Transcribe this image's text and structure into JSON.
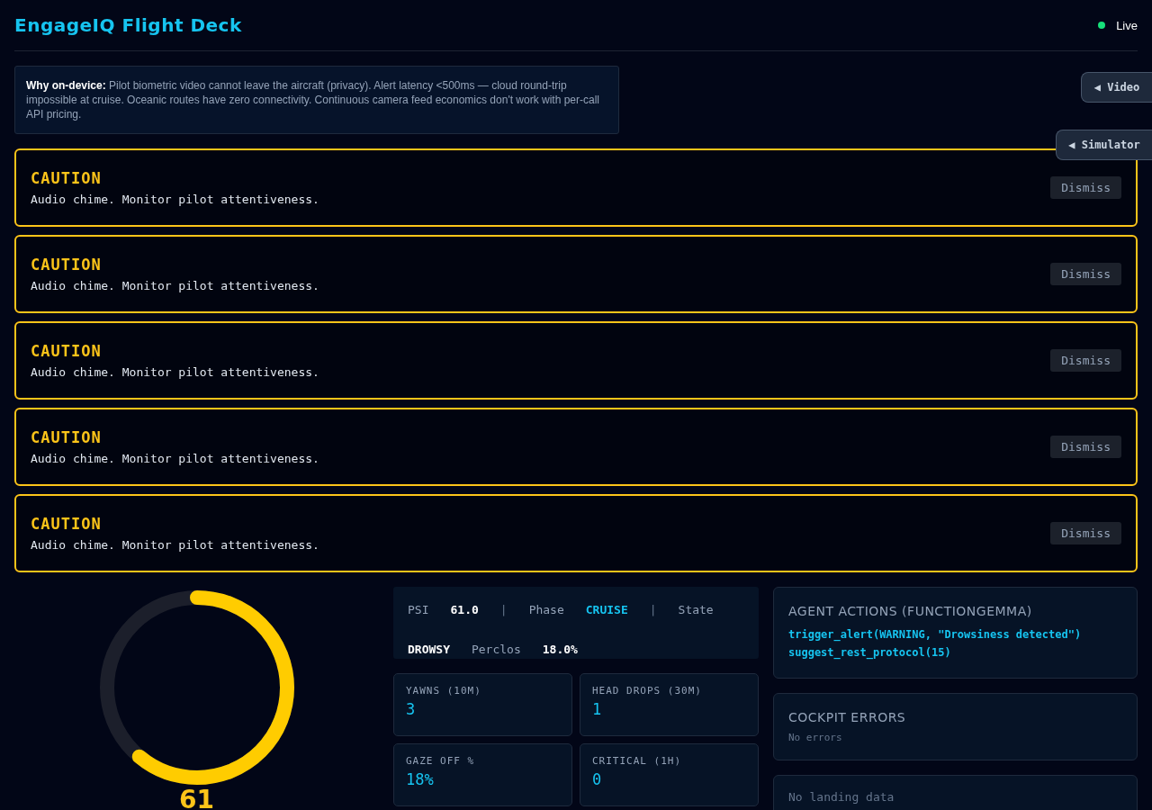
{
  "header": {
    "title": "EngageIQ Flight Deck",
    "status": {
      "label": "Live",
      "on": true
    }
  },
  "info": "**Why on-device:** Pilot biometric video cannot leave the aircraft (privacy). Alert latency <500ms — cloud round-trip impossible at cruise. Oceanic routes have zero connectivity. Continuous camera feed economics don't work with per-call API pricing.",
  "side_tabs": [
    {
      "icon": "◀",
      "label": "Video"
    },
    {
      "icon": "◀",
      "label": "Simulator"
    }
  ],
  "alerts": [
    {
      "title": "CAUTION",
      "message": "Audio chime. Monitor pilot attentiveness.",
      "action": "Dismiss"
    },
    {
      "title": "CAUTION",
      "message": "Audio chime. Monitor pilot attentiveness.",
      "action": "Dismiss"
    },
    {
      "title": "CAUTION",
      "message": "Audio chime. Monitor pilot attentiveness.",
      "action": "Dismiss"
    },
    {
      "title": "CAUTION",
      "message": "Audio chime. Monitor pilot attentiveness.",
      "action": "Dismiss"
    },
    {
      "title": "CAUTION",
      "message": "Audio chime. Monitor pilot attentiveness.",
      "action": "Dismiss"
    }
  ],
  "gauge": {
    "level": 0.61,
    "value": "61"
  },
  "status_bar": [
    {
      "kind": "label",
      "text": "PSI"
    },
    {
      "kind": "value",
      "text": "61.0"
    },
    {
      "kind": "separator",
      "text": "|"
    },
    {
      "kind": "label",
      "text": "Phase"
    },
    {
      "kind": "accent",
      "text": "CRUISE"
    },
    {
      "kind": "separator",
      "text": "|"
    },
    {
      "kind": "label",
      "text": "State"
    },
    {
      "kind": "value",
      "text": "DROWSY"
    },
    {
      "kind": "label",
      "text": "Perclos"
    },
    {
      "kind": "value",
      "text": "18.0%"
    }
  ],
  "metrics": [
    {
      "label": "YAWNS (10M)",
      "value": "3"
    },
    {
      "label": "HEAD DROPS (30M)",
      "value": "1"
    },
    {
      "label": "GAZE OFF %",
      "value": "18%"
    },
    {
      "label": "CRITICAL (1H)",
      "value": "0"
    }
  ],
  "agent_actions": {
    "title": "AGENT ACTIONS (FUNCTIONGEMMA)",
    "calls": [
      "trigger_alert(WARNING, \"Drowsiness detected\")",
      "suggest_rest_protocol(15)"
    ]
  },
  "cockpit_errors": {
    "title": "COCKPIT ERRORS",
    "empty_text": "No errors"
  },
  "landing": {
    "empty_text": "No landing data"
  }
}
